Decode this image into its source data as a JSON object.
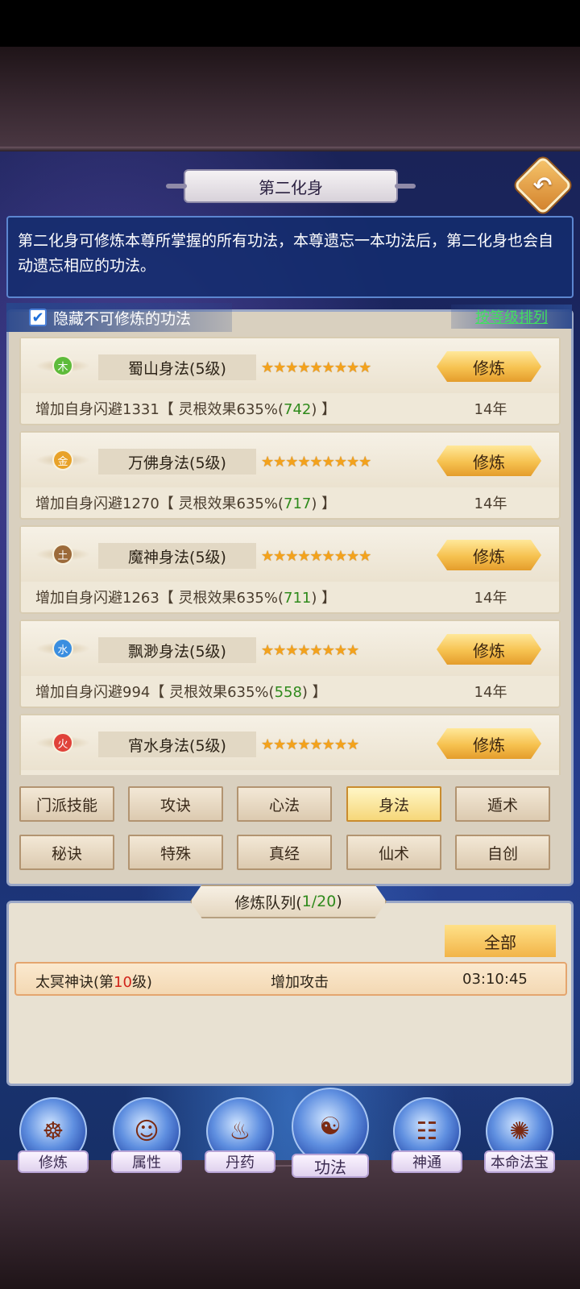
{
  "header": {
    "title": "第二化身",
    "back_icon": "↶"
  },
  "description": "第二化身可修炼本尊所掌握的所有功法，本尊遗忘一本功法后，第二化身也会自动遗忘相应的功法。",
  "filter": {
    "checkbox_mark": "✔",
    "hide_label": "隐藏不可修炼的功法",
    "sort_label": "按等级排列"
  },
  "skills": [
    {
      "element": "木",
      "element_color": "#5dbb3a",
      "name": "蜀山身法(5级)",
      "stars": "★★★★★★★★★",
      "button": "修炼",
      "effect_prefix": "增加自身闪避1331【 灵根效果635%(",
      "effect_value": "742",
      "effect_suffix": ") 】",
      "years": "14年"
    },
    {
      "element": "金",
      "element_color": "#e8a229",
      "name": "万佛身法(5级)",
      "stars": "★★★★★★★★★",
      "button": "修炼",
      "effect_prefix": "增加自身闪避1270【 灵根效果635%(",
      "effect_value": "717",
      "effect_suffix": ") 】",
      "years": "14年"
    },
    {
      "element": "土",
      "element_color": "#9c6a3a",
      "name": "魔神身法(5级)",
      "stars": "★★★★★★★★★",
      "button": "修炼",
      "effect_prefix": "增加自身闪避1263【 灵根效果635%(",
      "effect_value": "711",
      "effect_suffix": ") 】",
      "years": "14年"
    },
    {
      "element": "水",
      "element_color": "#3a8ee0",
      "name": "飘渺身法(5级)",
      "stars": "★★★★★★★★",
      "button": "修炼",
      "effect_prefix": "增加自身闪避994【 灵根效果635%(",
      "effect_value": "558",
      "effect_suffix": ") 】",
      "years": "14年"
    },
    {
      "element": "火",
      "element_color": "#e0423a",
      "name": "宵水身法(5级)",
      "stars": "★★★★★★★★",
      "button": "修炼",
      "effect_prefix": "",
      "effect_value": "",
      "effect_suffix": "",
      "years": ""
    }
  ],
  "tabs_row1": [
    "门派技能",
    "攻诀",
    "心法",
    "身法",
    "遁术"
  ],
  "tabs_row2": [
    "秘诀",
    "特殊",
    "真经",
    "仙术",
    "自创"
  ],
  "active_tab": "身法",
  "queue": {
    "title_prefix": "修炼队列(",
    "count": "1/20",
    "title_suffix": " )",
    "all_label": "全部",
    "item": {
      "name_prefix": "太冥神诀(第",
      "level": "10",
      "name_suffix": "级)",
      "effect": "增加攻击",
      "time": "03:10:45"
    }
  },
  "nav": [
    {
      "label": "修炼",
      "icon": "☸"
    },
    {
      "label": "属性",
      "icon": "☺"
    },
    {
      "label": "丹药",
      "icon": "♨"
    },
    {
      "label": "功法",
      "icon": "☯"
    },
    {
      "label": "神通",
      "icon": "☷"
    },
    {
      "label": "本命法宝",
      "icon": "✺"
    }
  ],
  "active_nav": "功法"
}
